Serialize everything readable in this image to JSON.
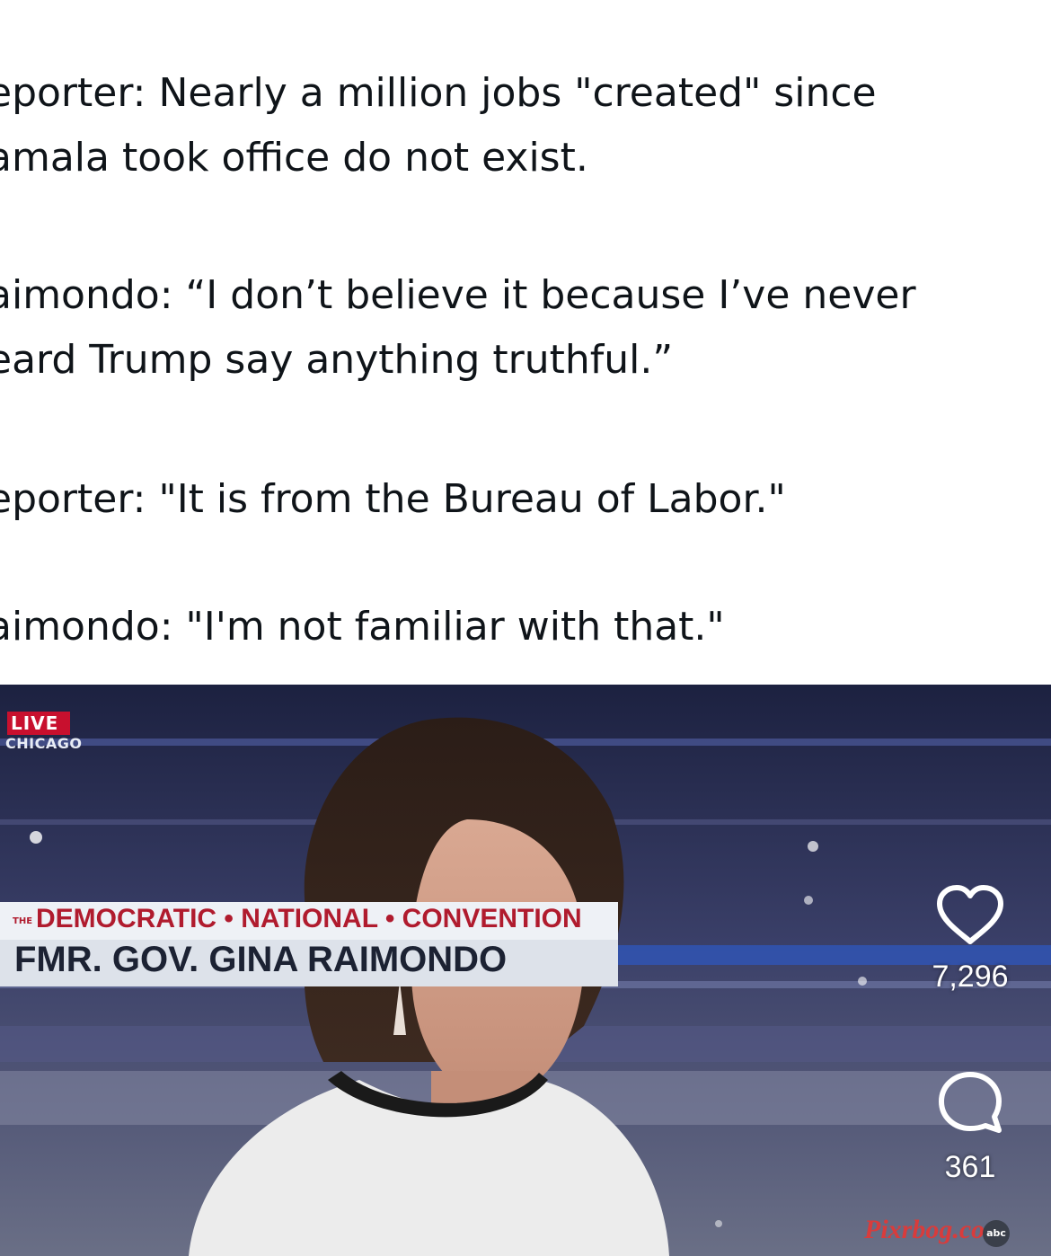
{
  "post": {
    "paragraphs": [
      [
        "eporter: Nearly a million jobs \"created\" since",
        "amala took office do not exist."
      ],
      [
        "aimondo: “I don’t believe it because I’ve never",
        "eard Trump say anything truthful.”"
      ],
      [
        "eporter: \"It is from the Bureau of Labor.\""
      ],
      [
        "aimondo: \"I'm not familiar with that.\""
      ]
    ]
  },
  "video": {
    "live_label": "LIVE",
    "location": "CHICAGO",
    "lower_third": {
      "prefix": "THE",
      "event": "DEMOCRATIC • NATIONAL • CONVENTION",
      "name": "FMR. GOV. GINA RAIMONDO"
    },
    "network": "abc",
    "watermark": "Pixrbog.com"
  },
  "actions": {
    "likes": "7,296",
    "comments": "361",
    "like_icon": "heart-icon",
    "comment_icon": "speech-bubble-icon"
  },
  "colors": {
    "text": "#0f1419",
    "live_red": "#c8102e",
    "convention_red": "#b01b2e"
  }
}
